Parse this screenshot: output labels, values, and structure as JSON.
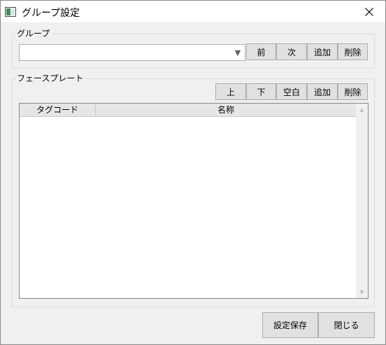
{
  "window": {
    "title": "グループ設定"
  },
  "group_section": {
    "legend": "グループ",
    "combo_value": "",
    "buttons": {
      "prev": "前",
      "next": "次",
      "add": "追加",
      "delete": "削除"
    }
  },
  "faceplate_section": {
    "legend": "フェースプレート",
    "buttons": {
      "up": "上",
      "down": "下",
      "blank": "空白",
      "add": "追加",
      "delete": "削除"
    },
    "table": {
      "columns": [
        "タグコード",
        "名称"
      ],
      "rows": []
    }
  },
  "footer": {
    "save": "設定保存",
    "close": "閉じる"
  },
  "icons": {
    "app": "window-app-icon",
    "close": "close-icon",
    "dropdown": "dropdown-arrow-icon",
    "scroll_up": "scroll-up-arrow-icon",
    "scroll_down": "scroll-down-arrow-icon"
  },
  "colors": {
    "window_bg": "#f0f0f0",
    "button_bg": "#e1e1e1",
    "header_bg": "#e6e6e6"
  }
}
